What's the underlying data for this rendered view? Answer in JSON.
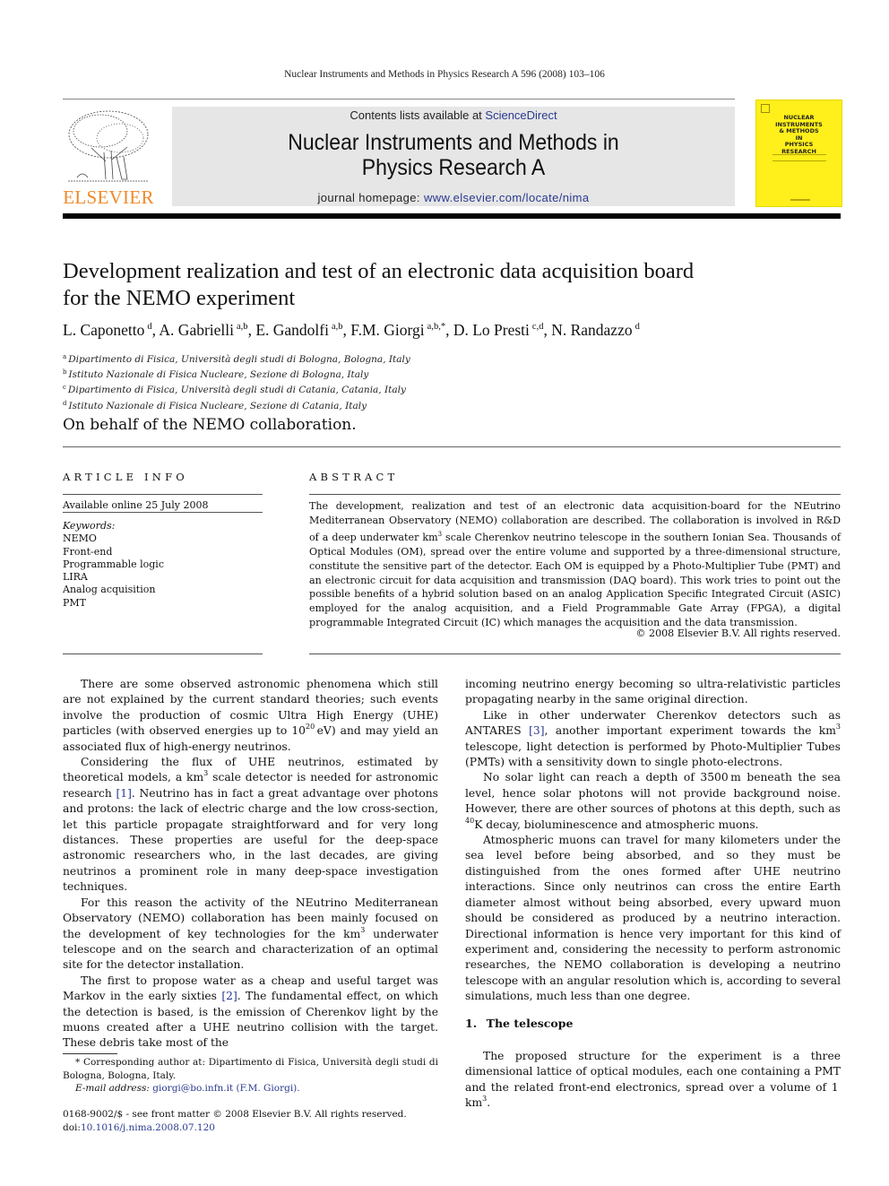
{
  "header": {
    "running_head": "Nuclear Instruments and Methods in Physics Research A 596 (2008) 103–106",
    "publisher_logo_text": "ELSEVIER",
    "contents_prefix": "Contents lists available at ",
    "contents_link": "ScienceDirect",
    "journal_title_line1": "Nuclear Instruments and Methods in",
    "journal_title_line2": "Physics Research A",
    "homepage_prefix": "journal homepage: ",
    "homepage_link": "www.elsevier.com/locate/nima",
    "cover_title": "NUCLEAR\nINSTRUMENTS\n& METHODS\nIN\nPHYSICS\nRESEARCH",
    "colors": {
      "elsevier_orange": "#f0892a",
      "link_blue": "#2a3a8f",
      "cover_yellow": "#ffef1a",
      "banner_gray": "#e6e6e6"
    }
  },
  "article": {
    "title_line1": "Development realization and test of an electronic data acquisition board",
    "title_line2": "for the NEMO experiment",
    "authors": [
      {
        "name": "L. Caponetto",
        "sup": "d"
      },
      {
        "name": "A. Gabrielli",
        "sup": "a,b"
      },
      {
        "name": "E. Gandolfi",
        "sup": "a,b"
      },
      {
        "name": "F.M. Giorgi",
        "sup": "a,b,*"
      },
      {
        "name": "D. Lo Presti",
        "sup": "c,d"
      },
      {
        "name": "N. Randazzo",
        "sup": "d"
      }
    ],
    "affiliations": [
      {
        "key": "a",
        "text": "Dipartimento di Fisica, Università degli studi di Bologna, Bologna, Italy"
      },
      {
        "key": "b",
        "text": "Istituto Nazionale di Fisica Nucleare, Sezione di Bologna, Italy"
      },
      {
        "key": "c",
        "text": "Dipartimento di Fisica, Università degli studi di Catania, Catania, Italy"
      },
      {
        "key": "d",
        "text": "Istituto Nazionale di Fisica Nucleare, Sezione di Catania, Italy"
      }
    ],
    "on_behalf": "On behalf of the NEMO collaboration."
  },
  "article_info": {
    "label": "ARTICLE INFO",
    "available": "Available online 25 July 2008",
    "keywords_label": "Keywords:",
    "keywords": [
      "NEMO",
      "Front-end",
      "Programmable logic",
      "LIRA",
      "Analog acquisition",
      "PMT"
    ]
  },
  "abstract": {
    "label": "ABSTRACT",
    "text_part1": "The development, realization and test of an electronic data acquisition-board for the NEutrino Mediterranean Observatory (NEMO) collaboration are described. The collaboration is involved in R&D of a deep underwater km",
    "sup1": "3",
    "text_part2": " scale Cherenkov neutrino telescope in the southern Ionian Sea. Thousands of Optical Modules (OM), spread over the entire volume and supported by a three-dimensional structure, constitute the sensitive part of the detector. Each OM is equipped by a Photo-Multiplier Tube (PMT) and an electronic circuit for data acquisition and transmission (DAQ board). This work tries to point out the possible benefits of a hybrid solution based on an analog Application Specific Integrated Circuit (ASIC) employed for the analog acquisition, and a Field Programmable Gate Array (FPGA), a digital programmable Integrated Circuit (IC) which manages the acquisition and the data transmission.",
    "copyright": "© 2008 Elsevier B.V. All rights reserved."
  },
  "body_left": {
    "p1_a": "There are some observed astronomic phenomena which still are not explained by the current standard theories; such events involve the production of cosmic Ultra High Energy (UHE) particles (with observed energies up to 10",
    "p1_sup": "20",
    "p1_b": " eV) and may yield an associated flux of high-energy neutrinos.",
    "p2_a": "Considering the flux of UHE neutrinos, estimated by theoretical models, a km",
    "p2_sup": "3",
    "p2_b": " scale detector is needed for astronomic research ",
    "p2_ref": "[1]",
    "p2_c": ". Neutrino has in fact a great advantage over photons and protons: the lack of electric charge and the low cross-section, let this particle propagate straightforward and for very long distances. These properties are useful for the deep-space astronomic researchers who, in the last decades, are giving neutrinos a prominent role in many deep-space investigation techniques.",
    "p3_a": "For this reason the activity of the NEutrino Mediterranean Observatory (NEMO) collaboration has been mainly focused on the development of key technologies for the km",
    "p3_sup": "3",
    "p3_b": " underwater telescope and on the search and characterization of an optimal site for the detector installation.",
    "p4_a": "The first to propose water as a cheap and useful target was Markov in the early sixties ",
    "p4_ref": "[2]",
    "p4_b": ". The fundamental effect, on which the detection is based, is the emission of Cherenkov light by the muons created after a UHE neutrino collision with the target. These debris take most of the"
  },
  "body_right": {
    "p1": "incoming neutrino energy becoming so ultra-relativistic particles propagating nearby in the same original direction.",
    "p2_a": "Like in other underwater Cherenkov detectors such as ANTARES ",
    "p2_ref": "[3]",
    "p2_b": ", another important experiment towards the km",
    "p2_sup": "3",
    "p2_c": " telescope, light detection is performed by Photo-Multiplier Tubes (PMTs) with a sensitivity down to single photo-electrons.",
    "p3_a": "No solar light can reach a depth of 3500 m beneath the sea level, hence solar photons will not provide background noise. However, there are other sources of photons at this depth, such as ",
    "p3_sup": "40",
    "p3_b": "K decay, bioluminescence and atmospheric muons.",
    "p4": "Atmospheric muons can travel for many kilometers under the sea level before being absorbed, and so they must be distinguished from the ones formed after UHE neutrino interactions. Since only neutrinos can cross the entire Earth diameter almost without being absorbed, every upward muon should be considered as produced by a neutrino interaction. Directional information is hence very important for this kind of experiment and, considering the necessity to perform astronomic researches, the NEMO collaboration is developing a neutrino telescope with an angular resolution which is, according to several simulations, much less than one degree.",
    "section_heading": "1.  The telescope",
    "p5_a": "The proposed structure for the experiment is a three dimensional lattice of optical modules, each one containing a PMT and the related front-end electronics, spread over a volume of 1 km",
    "p5_sup": "3",
    "p5_b": "."
  },
  "footnotes": {
    "corresponding": "* Corresponding author at: Dipartimento di Fisica, Università degli studi di Bologna, Bologna, Italy.",
    "email_label": "E-mail address: ",
    "email_link": "giorgi@bo.infn.it (F.M. Giorgi).",
    "front_matter": "0168-9002/$ - see front matter © 2008 Elsevier B.V. All rights reserved.",
    "doi_label": "doi:",
    "doi_link": "10.1016/j.nima.2008.07.120"
  }
}
